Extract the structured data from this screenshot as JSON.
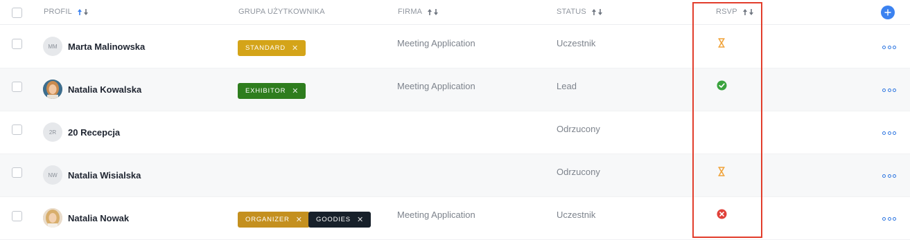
{
  "header": {
    "profil": "PROFIL",
    "grupa": "GRUPA UŻYTKOWNIKA",
    "firma": "FIRMA",
    "status": "STATUS",
    "rsvp": "RSVP"
  },
  "icons": {
    "add": "plus-icon",
    "more": "more-dots-icon",
    "sort": "sort-arrows-icon",
    "rsvp_pending": "hourglass-icon",
    "rsvp_accepted": "check-circle-icon",
    "rsvp_declined": "x-circle-icon"
  },
  "colors": {
    "accent": "#3b82f0",
    "tag_standard": "#d4a419",
    "tag_exhibitor": "#2e7d1e",
    "tag_organizer": "#c4901f",
    "tag_goodies": "#17202a",
    "rsvp_pending": "#f0a33a",
    "rsvp_accepted": "#3aa33e",
    "rsvp_declined": "#e0413a",
    "highlight": "#e23d2b"
  },
  "rows": [
    {
      "initials": "MM",
      "name": "Marta Malinowska",
      "tags": [
        {
          "label": "STANDARD",
          "color": "#d4a419"
        }
      ],
      "firma": "Meeting Application",
      "status": "Uczestnik",
      "rsvp": "pending"
    },
    {
      "initials": "",
      "name": "Natalia Kowalska",
      "tags": [
        {
          "label": "EXHIBITOR",
          "color": "#2e7d1e"
        }
      ],
      "firma": "Meeting Application",
      "status": "Lead",
      "rsvp": "accepted"
    },
    {
      "initials": "2R",
      "name": "20 Recepcja",
      "tags": [],
      "firma": "",
      "status": "Odrzucony",
      "rsvp": ""
    },
    {
      "initials": "NW",
      "name": "Natalia Wisialska",
      "tags": [],
      "firma": "",
      "status": "Odrzucony",
      "rsvp": "pending"
    },
    {
      "initials": "",
      "name": "Natalia Nowak",
      "tags": [
        {
          "label": "ORGANIZER",
          "color": "#c4901f"
        },
        {
          "label": "GOODIES",
          "color": "#17202a"
        }
      ],
      "firma": "Meeting Application",
      "status": "Uczestnik",
      "rsvp": "declined"
    }
  ]
}
